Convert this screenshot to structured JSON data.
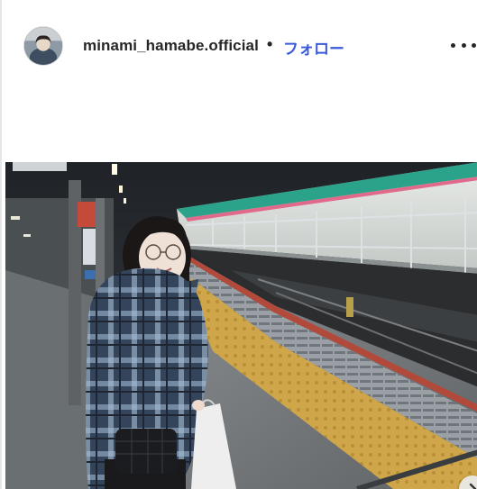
{
  "post_header": {
    "username": "minami_hamabe.official",
    "separator": "•",
    "follow_label": "フォロー"
  },
  "icons": {
    "avatar": "profile-avatar",
    "more": "more-options-icon",
    "next": "chevron-right-icon"
  },
  "colors": {
    "follow": "#3b5bdb",
    "username": "#262626"
  }
}
